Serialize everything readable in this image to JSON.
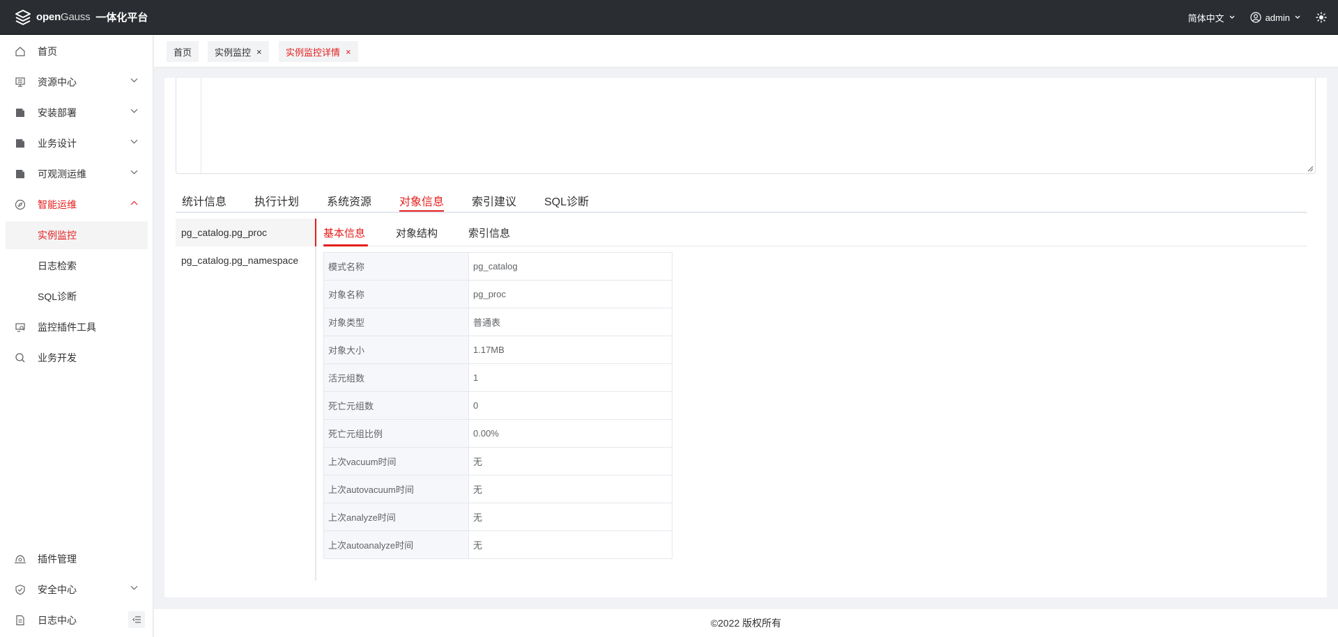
{
  "app": {
    "brand_open": "open",
    "brand_gauss": "Gauss",
    "title": "一体化平台"
  },
  "header": {
    "language": "简体中文",
    "user": "admin",
    "icons": [
      "language-chevron-icon",
      "user-icon",
      "theme-sun-icon"
    ]
  },
  "sidebar": {
    "items": [
      {
        "label": "首页",
        "icon": "home-icon"
      },
      {
        "label": "资源中心",
        "icon": "resource-icon"
      },
      {
        "label": "安装部署",
        "icon": "install-icon"
      },
      {
        "label": "业务设计",
        "icon": "design-icon"
      },
      {
        "label": "可观测运维",
        "icon": "observe-icon"
      },
      {
        "label": "智能运维",
        "icon": "compass-icon"
      },
      {
        "label": "监控插件工具",
        "icon": "monitor-plugin-icon"
      },
      {
        "label": "业务开发",
        "icon": "search-icon"
      },
      {
        "label": "插件管理",
        "icon": "plugin-icon"
      },
      {
        "label": "安全中心",
        "icon": "shield-icon"
      },
      {
        "label": "日志中心",
        "icon": "log-icon"
      }
    ],
    "sub_items": [
      "实例监控",
      "日志检索",
      "SQL诊断"
    ],
    "accent": "#e41d1d"
  },
  "tags": [
    {
      "label": "首页"
    },
    {
      "label": "实例监控",
      "close": "×"
    },
    {
      "label": "实例监控详情",
      "close": "×"
    }
  ],
  "main_tabs": [
    "统计信息",
    "执行计划",
    "系统资源",
    "对象信息",
    "索引建议",
    "SQL诊断"
  ],
  "objects": [
    "pg_catalog.pg_proc",
    "pg_catalog.pg_namespace"
  ],
  "sub_tabs": [
    "基本信息",
    "对象结构",
    "索引信息"
  ],
  "info_rows": [
    {
      "key": "模式名称",
      "value": "pg_catalog"
    },
    {
      "key": "对象名称",
      "value": "pg_proc"
    },
    {
      "key": "对象类型",
      "value": "普通表"
    },
    {
      "key": "对象大小",
      "value": "1.17MB"
    },
    {
      "key": "活元组数",
      "value": "1"
    },
    {
      "key": "死亡元组数",
      "value": "0"
    },
    {
      "key": "死亡元组比例",
      "value": "0.00%"
    },
    {
      "key": "上次vacuum时间",
      "value": "无"
    },
    {
      "key": "上次autovacuum时间",
      "value": "无"
    },
    {
      "key": "上次analyze时间",
      "value": "无"
    },
    {
      "key": "上次autoanalyze时间",
      "value": "无"
    }
  ],
  "footer": "©2022 版权所有"
}
